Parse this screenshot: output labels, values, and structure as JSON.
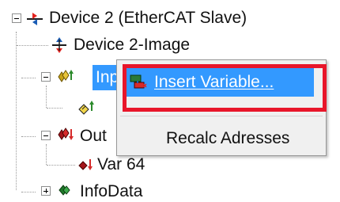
{
  "tree": {
    "device": {
      "label": "Device 2 (EtherCAT Slave)",
      "expanded": true
    },
    "image": {
      "label": "Device 2-Image"
    },
    "inputs": {
      "label": "Inp",
      "expanded": true,
      "selected": true
    },
    "inputs_child": {
      "label": ""
    },
    "outputs": {
      "label": "Out",
      "expanded": true
    },
    "outputs_child": {
      "label": "Var 64"
    },
    "infodata": {
      "label": "InfoData",
      "expanded": false
    }
  },
  "context_menu": {
    "items": [
      {
        "label": "Insert Variable...",
        "highlighted": true,
        "icon": "insert-variable-icon"
      },
      {
        "label": "Recalc Adresses",
        "highlighted": false
      }
    ]
  },
  "colors": {
    "highlight": "#3399ff",
    "callout": "#e8162a",
    "menu_bg": "#f0f0f0"
  }
}
